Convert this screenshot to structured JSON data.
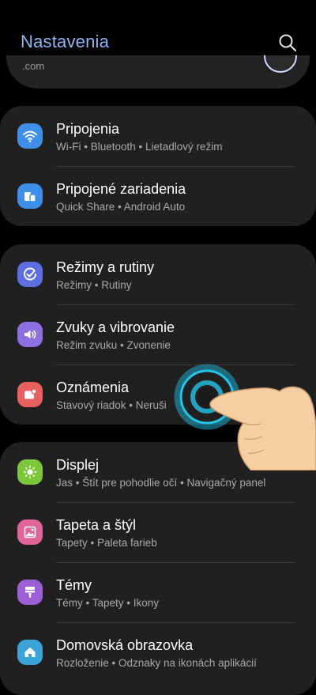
{
  "header": {
    "title": "Nastavenia"
  },
  "account": {
    "email_fragment": ".com"
  },
  "groups": [
    [
      {
        "label": "Pripojenia",
        "sub": "Wi-Fi  •  Bluetooth  •  Lietadlový režim",
        "icon": "wifi-icon",
        "color": "#3f8fe8"
      },
      {
        "label": "Pripojené zariadenia",
        "sub": "Quick Share  •  Android Auto",
        "icon": "devices-icon",
        "color": "#3f8fe8"
      }
    ],
    [
      {
        "label": "Režimy a rutiny",
        "sub": "Režimy  •  Rutiny",
        "icon": "check-circle-icon",
        "color": "#5d6ee0"
      },
      {
        "label": "Zvuky a vibrovanie",
        "sub": "Režim zvuku  •  Zvonenie",
        "icon": "speaker-icon",
        "color": "#8c6fe0"
      },
      {
        "label": "Oznámenia",
        "sub": "Stavový riadok  •  Neruši",
        "icon": "notification-icon",
        "color": "#e86060"
      }
    ],
    [
      {
        "label": "Displej",
        "sub": "Jas  •  Štít pre pohodlie očí  •  Navigačný panel",
        "icon": "sun-icon",
        "color": "#7bc639"
      },
      {
        "label": "Tapeta a štýl",
        "sub": "Tapety  •  Paleta farieb",
        "icon": "wallpaper-icon",
        "color": "#e16596"
      },
      {
        "label": "Témy",
        "sub": "Témy  •  Tapety  •  Ikony",
        "icon": "brush-icon",
        "color": "#9c5fd6"
      },
      {
        "label": "Domovská obrazovka",
        "sub": "Rozloženie  •  Odznaky na ikonách aplikácií",
        "icon": "home-icon",
        "color": "#3aa3d8"
      }
    ]
  ]
}
